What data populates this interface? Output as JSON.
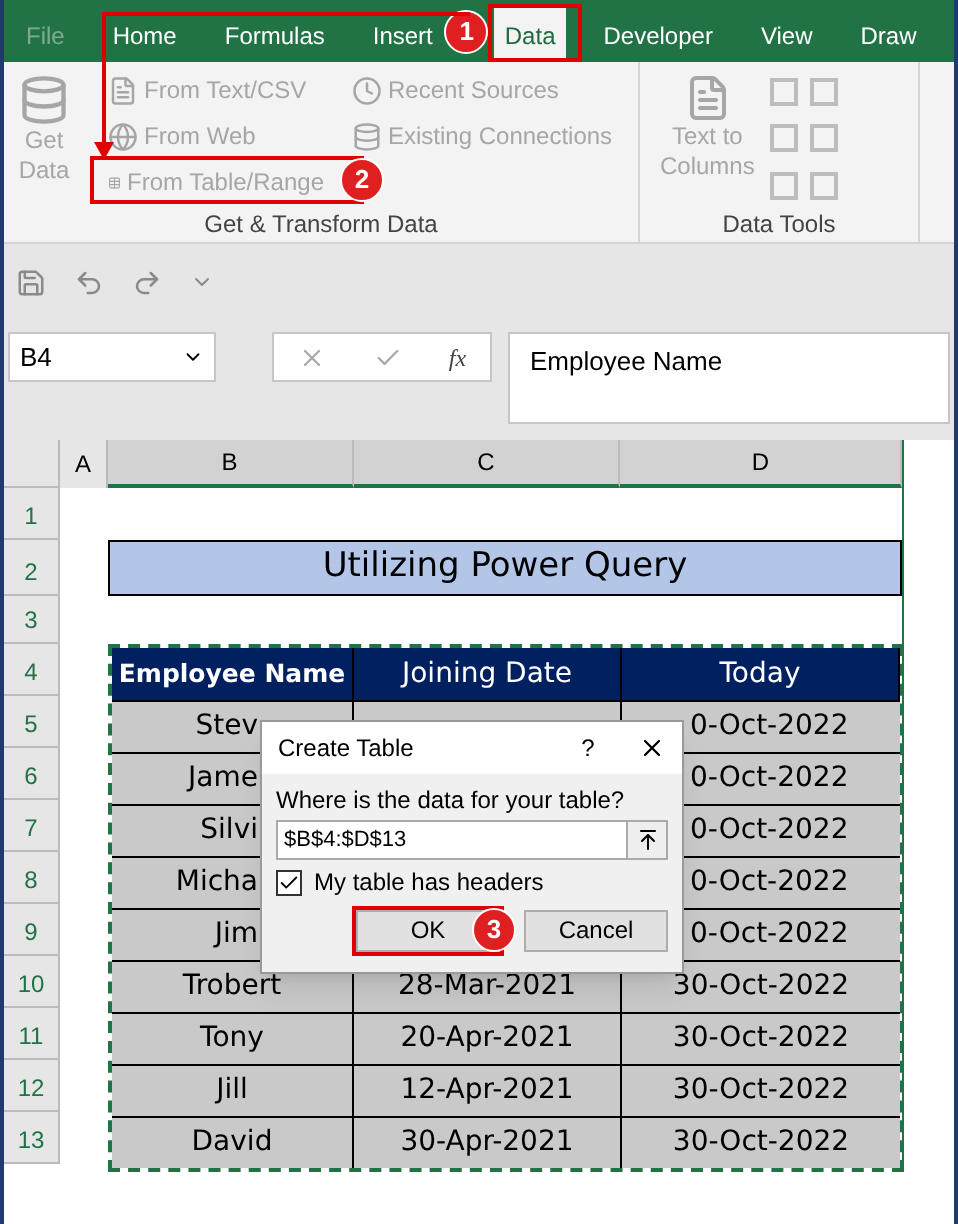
{
  "ribbon_tabs": [
    {
      "label": "File",
      "selected": false,
      "dimmed": true
    },
    {
      "label": "Home",
      "selected": false,
      "dimmed": false
    },
    {
      "label": "Formulas",
      "selected": false,
      "dimmed": false
    },
    {
      "label": "Insert",
      "selected": false,
      "dimmed": false
    },
    {
      "label": "Data",
      "selected": true,
      "dimmed": false
    },
    {
      "label": "Developer",
      "selected": false,
      "dimmed": false
    },
    {
      "label": "View",
      "selected": false,
      "dimmed": false
    },
    {
      "label": "Draw",
      "selected": false,
      "dimmed": false
    }
  ],
  "get_transform": {
    "get_data": [
      "Get",
      "Data"
    ],
    "commands": [
      {
        "label": "From Text/CSV",
        "kind": "text"
      },
      {
        "label": "From Web",
        "kind": "web"
      },
      {
        "label": "From Table/Range",
        "kind": "table"
      }
    ],
    "sources": [
      {
        "label": "Recent Sources",
        "kind": "recent"
      },
      {
        "label": "Existing Connections",
        "kind": "connections"
      }
    ],
    "label": "Get & Transform Data"
  },
  "data_tools": {
    "text_to_columns": [
      "Text to",
      "Columns"
    ],
    "label": "Data Tools"
  },
  "name_box": "B4",
  "function_label": "fx",
  "formula": "Employee Name",
  "columns": [
    "A",
    "B",
    "C",
    "D"
  ],
  "row_numbers": [
    "1",
    "2",
    "3",
    "4",
    "5",
    "6",
    "7",
    "8",
    "9",
    "10",
    "11",
    "12",
    "13"
  ],
  "sheet_title": "Utilizing Power Query",
  "table": {
    "headers": [
      "Employee Name",
      "Joining Date",
      "Today"
    ],
    "rows": [
      {
        "name": "Stev",
        "today": "0-Oct-2022",
        "covered": true
      },
      {
        "name": "Jame",
        "today": "0-Oct-2022",
        "covered": true
      },
      {
        "name": "Silvi",
        "today": "0-Oct-2022",
        "covered": true
      },
      {
        "name": "Micha",
        "today": "0-Oct-2022",
        "covered": true
      },
      {
        "name": "Jim",
        "today": "0-Oct-2022",
        "covered": true
      },
      {
        "name": "Trobert",
        "joining": "28-Mar-2021",
        "today": "30-Oct-2022",
        "covered": false
      },
      {
        "name": "Tony",
        "joining": "20-Apr-2021",
        "today": "30-Oct-2022",
        "covered": false
      },
      {
        "name": "Jill",
        "joining": "12-Apr-2021",
        "today": "30-Oct-2022",
        "covered": false
      },
      {
        "name": "David",
        "joining": "30-Apr-2021",
        "today": "30-Oct-2022",
        "covered": false
      }
    ]
  },
  "dialog": {
    "title": "Create Table",
    "help": "?",
    "prompt": "Where is the data for your table?",
    "range": "$B$4:$D$13",
    "headers_label": "My table has headers",
    "headers_checked": true,
    "buttons": [
      "OK",
      "Cancel"
    ]
  },
  "steps": [
    "1",
    "2",
    "3"
  ]
}
